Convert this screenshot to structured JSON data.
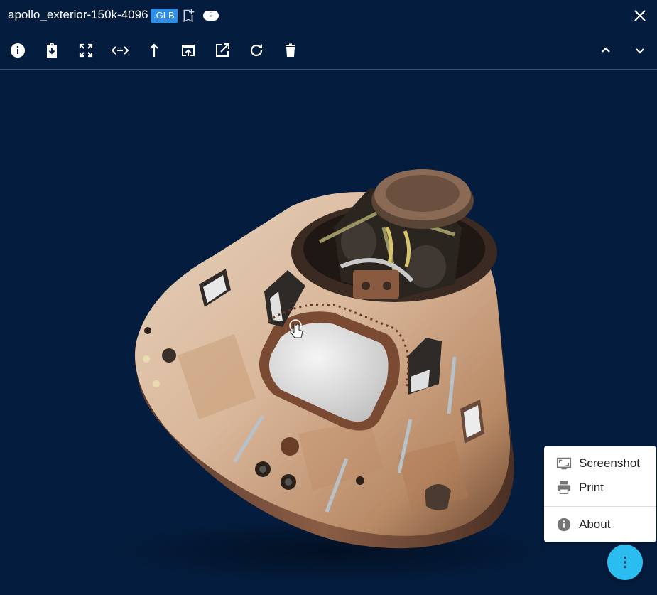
{
  "header": {
    "title": "apollo_exterior-150k-4096",
    "format_badge": ".GLB",
    "bookmark_count": "2"
  },
  "toolbar": {
    "left_icons": [
      "info-icon",
      "download-clipboard-icon",
      "fullscreen-icon",
      "code-arrows-icon",
      "arrow-up-icon",
      "open-in-icon",
      "external-link-icon",
      "refresh-icon",
      "delete-icon"
    ],
    "right_icons": [
      "chevron-up-icon",
      "chevron-down-icon"
    ]
  },
  "context_menu": {
    "items": [
      {
        "label": "Screenshot",
        "icon": "screenshot-icon"
      },
      {
        "label": "Print",
        "icon": "print-icon"
      },
      {
        "label": "About",
        "icon": "info-icon"
      }
    ]
  },
  "colors": {
    "background": "#041c3d",
    "badge": "#2f8fe6",
    "fab": "#2bbcf0"
  }
}
